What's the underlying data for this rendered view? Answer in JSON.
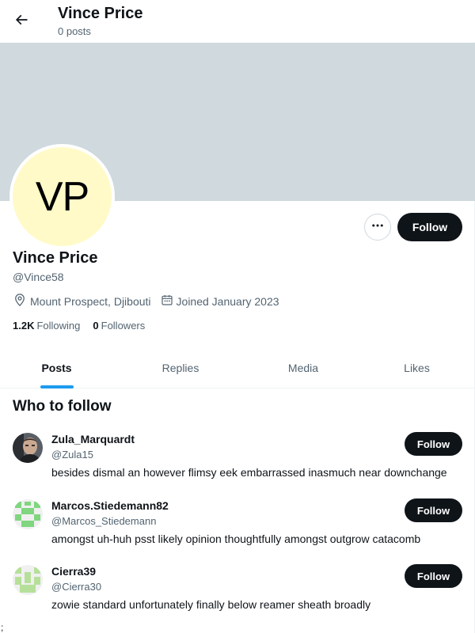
{
  "header": {
    "title": "Vince Price",
    "subtitle": "0 posts",
    "back_icon": "arrow-left-icon"
  },
  "banner": {
    "color": "#cfd9de"
  },
  "profile": {
    "avatar_text": "VP",
    "avatar_color": "#fffac8",
    "name": "Vince Price",
    "handle": "@Vince58",
    "location": "Mount Prospect, Djibouti",
    "joined": "Joined January 2023",
    "following_count": "1.2K",
    "following_label": "Following",
    "followers_count": "0",
    "followers_label": "Followers",
    "more_label": "···",
    "follow_label": "Follow"
  },
  "tabs": [
    {
      "label": "Posts",
      "active": true
    },
    {
      "label": "Replies",
      "active": false
    },
    {
      "label": "Media",
      "active": false
    },
    {
      "label": "Likes",
      "active": false
    }
  ],
  "who_to_follow": {
    "title": "Who to follow",
    "items": [
      {
        "name": "Zula_Marquardt",
        "handle": "@Zula15",
        "bio": "besides dismal an however flimsy eek embarrassed inasmuch near downchange",
        "follow_label": "Follow",
        "avatar": "photo-avatar"
      },
      {
        "name": "Marcos.Stiedemann82",
        "handle": "@Marcos_Stiedemann",
        "bio": "amongst uh-huh psst likely opinion thoughtfully amongst outgrow catacomb",
        "follow_label": "Follow",
        "avatar": "identicon-green"
      },
      {
        "name": "Cierra39",
        "handle": "@Cierra30",
        "bio": "zowie standard unfortunately finally below reamer sheath broadly",
        "follow_label": "Follow",
        "avatar": "identicon-lightgreen"
      }
    ]
  },
  "accent_color": "#1d9bf0",
  "stray_text": ";"
}
